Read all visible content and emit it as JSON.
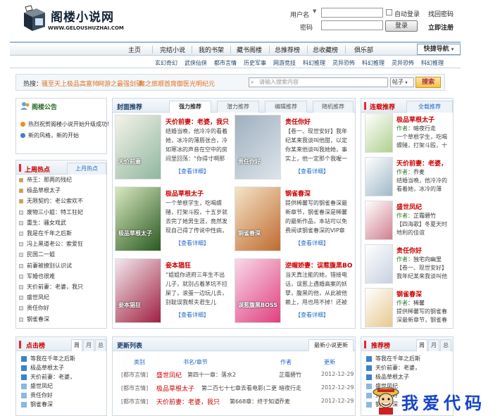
{
  "header": {
    "logo_name": "阁楼小说网",
    "logo_url": "WWW.GELOUSHUZHAI.COM"
  },
  "login": {
    "username_label": "用户名",
    "password_label": "密码",
    "auto_login": "自动登录",
    "forgot": "找回密码",
    "login_btn": "登录",
    "register": "立即注册"
  },
  "nav": {
    "items": [
      "主页",
      "完结小说",
      "我的书架",
      "藏书阁楼",
      "总推荐榜",
      "总收藏榜",
      "俱乐部"
    ],
    "fast_nav": "快捷导航"
  },
  "subnav": [
    "玄幻奇幻",
    "武侠仙侠",
    "都市言情",
    "历史军事",
    "网游竞技",
    "科幻推理",
    "灵异恐怖",
    "科幻推理",
    "灵异恐怖",
    "科幻推理"
  ],
  "hot": {
    "label": "热搜：",
    "items": [
      "骚至天上",
      "极品高富帅",
      "网游之最强剑驿",
      "魔之旅顺",
      "首席御医",
      "光明纪元"
    ],
    "search_placeholder": "请输入搜索内容",
    "select": "帖子",
    "btn": "搜索"
  },
  "notice": {
    "title": "阁楼公告",
    "items": [
      "热烈祝贺阁楼小说开始升级成功!",
      "新的风格，新的开始"
    ]
  },
  "week_hot": {
    "tab1": "上周热点",
    "tab2": "上月热点",
    "items": [
      "帝王：那两的残纪",
      "极品草根太子",
      "无限契约：老公索欢不",
      "废物三小姐：特工狂妃",
      "重生：骚女戏武",
      "我是在千年之后斯",
      "冯上黑道老公：索爱狂",
      "民国二一姐",
      "前妻被撩别认识试",
      "军婚也很难",
      "天价前妻：老婆，我只",
      "盛世凤纪",
      "贵任你好",
      "钢雀春深"
    ]
  },
  "center": {
    "title": "封面推荐",
    "tabs": [
      "强力推荐",
      "潜力推荐",
      "编辑推荐",
      "随机推荐"
    ],
    "books": [
      {
        "title": "天价前妻：老婆，我只",
        "desc": "结婚当晚，他冷冷的看着她，冰冷的薄唇张合，冷如寒冰的声音在空中的房间里回荡：“你得寸啊那晚我会来和你行",
        "more": "【查看详细】",
        "cover_text": "天价前妻"
      },
      {
        "title": "贵任你好",
        "desc": "【卷一、现世安好】我年纪某来我谈叫他甜，以定你某来他谈叫我她她，事实上，他一定那个我喔一截吵",
        "more": "【查看详细】",
        "cover_text": "贵任你好"
      },
      {
        "title": "极品草根太子",
        "desc": "一个草根学生，吃喝嫖赌，打架斗殴，十五岁就去完了她男生涯，竟然发现自己得了传说中性病，却在租公的尸上无意",
        "more": "【查看详细】",
        "cover_text": "极品草根太子"
      },
      {
        "title": "钢雀春深",
        "desc": "提供稀馨写的钢雀春深最新章节，钢雀春深是稀馨的最新作品，本站可以免费阅读钢雀春深的VIP章节！【经典文学",
        "more": "【查看详细】",
        "cover_text": "铜雀春深"
      },
      {
        "title": "妾本猖狂",
        "desc": "“姐姐你进府三年生不出儿子，就别占着茅坑不拉屎了，滚蛋一边玩儿去，别耽误我帮夫君生儿子！”小妾毅小小一",
        "more": "【查看详细】",
        "cover_text": "妾本猖狂"
      },
      {
        "title": "逆帽娇妻：误惹腹黑BO",
        "desc": "当天真注能的她，错接电话，误惹上遇婚高案的妖孽，腹黑的他，从此被他赖上，甩也甩不掉！还被小娇妻，遇",
        "more": "【查看详细】",
        "cover_text": "误惹腹黑BOSS"
      }
    ]
  },
  "right": {
    "tab1": "连载推荐",
    "tab2": "全载推荐",
    "books": [
      {
        "title": "极品草根太子",
        "author_label": "作者：",
        "author": "暗夜行走",
        "desc": "一个草根学生，吃喝嫖赌，打架斗殴，十"
      },
      {
        "title": "天价前妻：老婆，",
        "author_label": "作者：",
        "author": "乔麦",
        "desc": "结婚当晚，他冷冷的看着她，冰冷的薄"
      },
      {
        "title": "盛世凤纪",
        "author_label": "作者：",
        "author": "芷霜碧竹",
        "desc": "【四海歌】冬夏天时地利的佳谊"
      },
      {
        "title": "贵任你好",
        "author_label": "作者：",
        "author": "独宅向幽里",
        "desc": "【卷一、现世安好】我年纪某来我谈叫他"
      },
      {
        "title": "钢雀春深",
        "author_label": "作者：",
        "author": "稀馨",
        "desc": "提供稀馨写的钢雀春深最新章节，钢雀春"
      }
    ]
  },
  "click_rank": {
    "title": "点击榜",
    "tabs": [
      "周",
      "月",
      "总"
    ],
    "items": [
      "等我在千年之后斯",
      "极品草根太子",
      "天价前妻：老婆，",
      "盛世凤纪",
      "贵任你好",
      "钢雀春深"
    ]
  },
  "updates": {
    "title": "更新列表",
    "tab": "最新小说更新",
    "headers": [
      "类别",
      "书名/章节",
      "作者",
      "更新"
    ],
    "rows": [
      {
        "cat": "[都市言情]",
        "book": "盛世凤纪",
        "chapter": "第四十一章：落水2",
        "author": "芷霜碧竹",
        "date": "2012-12-29"
      },
      {
        "cat": "[都市言情]",
        "book": "极品草根太子",
        "chapter": "第二百七十七章去看电影(二更",
        "author": "暗夜行走",
        "date": "2012-12-29"
      },
      {
        "cat": "[都市言情]",
        "book": "天价前妻：老婆，我只",
        "chapter": "第668章：终于知道钱",
        "author": "乔麦",
        "date": "2012-12-29"
      }
    ]
  },
  "rec_rank": {
    "title": "推荐榜",
    "tabs": [
      "周",
      "月",
      "总"
    ],
    "items": [
      "等我在千年之后斯",
      "天价前妻：老婆，",
      "极品草根太子",
      "盛世凤纪",
      "贵任你好",
      "钢雀春深"
    ]
  },
  "watermark": "我爱代码",
  "colors": {
    "accent_red": "#cc0000",
    "link_blue": "#2266cc",
    "border": "#cdd9e3"
  }
}
